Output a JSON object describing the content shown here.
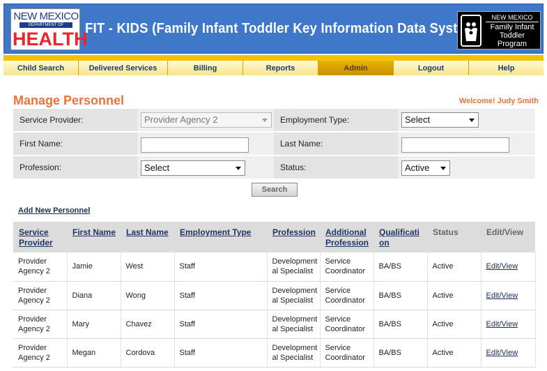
{
  "header": {
    "nm_logo": {
      "line1": "NEW MEXICO",
      "line2": "DEPARTMENT OF",
      "line3": "HEALTH"
    },
    "title": "FIT - KIDS (Family Infant Toddler Key Information Data System)",
    "fit_logo": {
      "line1": "NEW MEXICO",
      "line2": "Family Infant",
      "line3": "Toddler Program"
    }
  },
  "nav": [
    {
      "label": "Child Search"
    },
    {
      "label": "Delivered Services"
    },
    {
      "label": "Billing"
    },
    {
      "label": "Reports"
    },
    {
      "label": "Admin",
      "active": true
    },
    {
      "label": "Logout"
    },
    {
      "label": "Help"
    }
  ],
  "page": {
    "title": "Manage Personnel",
    "welcome": "Welcome! Judy Smith"
  },
  "form": {
    "service_provider_label": "Service Provider:",
    "service_provider_value": "Provider Agency 2",
    "employment_type_label": "Employment Type:",
    "employment_type_value": "Select",
    "first_name_label": "First Name:",
    "first_name_value": "",
    "last_name_label": "Last Name:",
    "last_name_value": "",
    "profession_label": "Profession:",
    "profession_value": "Select",
    "status_label": "Status:",
    "status_value": "Active",
    "search_label": "Search",
    "add_new_label": "Add New Personnel"
  },
  "table": {
    "columns": [
      "Service Provider",
      "First Name",
      "Last Name",
      "Employment Type",
      "Profession",
      "Additional Profession",
      "Qualification",
      "Status",
      "Edit/View"
    ],
    "header_lines": [
      [
        "Service ",
        "Provider"
      ],
      [
        "First Name",
        ""
      ],
      [
        "Last Name",
        ""
      ],
      [
        "Employment Type",
        ""
      ],
      [
        "Profession",
        ""
      ],
      [
        "Additional ",
        "Profession"
      ],
      [
        "Qualificati",
        "on"
      ],
      [
        "Status",
        ""
      ],
      [
        "Edit/View",
        ""
      ]
    ],
    "rows": [
      {
        "provider": [
          "Provider",
          "Agency 2"
        ],
        "first": "Jamie",
        "last": "West",
        "employment": "Staff",
        "profession": [
          "Development",
          "al Specialist"
        ],
        "additional": [
          "Service",
          "Coordinator"
        ],
        "qualification": "BA/BS",
        "status": "Active",
        "edit": "Edit/View"
      },
      {
        "provider": [
          "Provider",
          "Agency 2"
        ],
        "first": "Diana",
        "last": "Wong",
        "employment": "Staff",
        "profession": [
          "Development",
          "al Specialist"
        ],
        "additional": [
          "Service",
          "Coordinator"
        ],
        "qualification": "BA/BS",
        "status": "Active",
        "edit": "Edit/View"
      },
      {
        "provider": [
          "Provider",
          "Agency 2"
        ],
        "first": "Mary",
        "last": "Chavez",
        "employment": "Staff",
        "profession": [
          "Development",
          "al Specialist"
        ],
        "additional": [
          "Service",
          "Coordinator"
        ],
        "qualification": "BA/BS",
        "status": "Active",
        "edit": "Edit/View"
      },
      {
        "provider": [
          "Provider",
          "Agency 2"
        ],
        "first": "Megan",
        "last": "Cordova",
        "employment": "Staff",
        "profession": [
          "Development",
          "al Specialist"
        ],
        "additional": [
          "Service",
          "Coordinator"
        ],
        "qualification": "BA/BS",
        "status": "Active",
        "edit": "Edit/View"
      }
    ]
  },
  "colors": {
    "header_blue": "#3f78c8",
    "nav_yellow": "#f2c200",
    "title_orange": "#e8743b",
    "link_navy": "#1a2d5c"
  }
}
